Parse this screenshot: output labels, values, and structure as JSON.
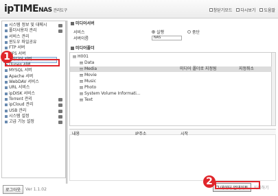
{
  "header": {
    "logo_main": "ipTIME",
    "logo_nas": "NAS",
    "logo_sub": "관리도구",
    "links": [
      "창닫기모드",
      "다시보기",
      "도움말"
    ]
  },
  "sidebar": {
    "items": [
      {
        "label": "시스템 정보 및 대메시",
        "sel": false
      },
      {
        "label": "폴더사용자 관리",
        "sel": false
      },
      {
        "label": "서비스 관리",
        "sel": false
      },
      {
        "label": "윈도우 파일공유",
        "sel": false
      },
      {
        "label": "FTP 서버",
        "sel": false
      },
      {
        "label": "NFS 서버",
        "sel": false
      },
      {
        "label": "미디어 서버",
        "sel": true
      },
      {
        "label": "iTunes 서버",
        "sel": false
      },
      {
        "label": "MYSQL 서버",
        "sel": false
      },
      {
        "label": "Apache 서버",
        "sel": false
      },
      {
        "label": "WebDAV 서비스",
        "sel": false
      },
      {
        "label": "URL 서비스",
        "sel": false
      },
      {
        "label": "ipDISK 서비스",
        "sel": false
      },
      {
        "label": "Torrent 관리",
        "sel": false
      },
      {
        "label": "ipCloud 관리",
        "sel": false
      },
      {
        "label": "USB 관리",
        "sel": false
      },
      {
        "label": "시스템 설정",
        "sel": false
      },
      {
        "label": "고급 기능 설정",
        "sel": false
      }
    ],
    "logout": "로그아웃",
    "version": "Ver 1.1.02"
  },
  "main": {
    "service_title": "미디어서버",
    "service_label": "서비스",
    "opt_run": "실행",
    "opt_stop": "중단",
    "server_name_label": "서버이름",
    "server_name_value": "NAS",
    "folder_title": "미디어폴더",
    "tree": [
      {
        "label": "H001",
        "indent": 0,
        "hl": false,
        "note": "",
        "note2": ""
      },
      {
        "label": "Data",
        "indent": 1,
        "hl": false,
        "note": "",
        "note2": ""
      },
      {
        "label": "Media",
        "indent": 1,
        "hl": true,
        "note": "미디어 폴더로 지정됨",
        "note2": "지정취소"
      },
      {
        "label": "Movie",
        "indent": 1,
        "hl": false,
        "note": "",
        "note2": ""
      },
      {
        "label": "Music",
        "indent": 1,
        "hl": false,
        "note": "",
        "note2": ""
      },
      {
        "label": "Photo",
        "indent": 1,
        "hl": false,
        "note": "",
        "note2": ""
      },
      {
        "label": "System Volume Informati...",
        "indent": 1,
        "hl": false,
        "note": "",
        "note2": ""
      },
      {
        "label": "Text",
        "indent": 1,
        "hl": false,
        "note": "",
        "note2": ""
      }
    ],
    "log_cols": [
      "내용",
      "IP주소",
      "시작"
    ],
    "db_update": "데이터 업데이트",
    "db_reset": "지워하기"
  },
  "annotations": [
    "1",
    "2"
  ],
  "colors": {
    "annotation": "#e0262b",
    "selected_bg": "#e2edf8"
  }
}
